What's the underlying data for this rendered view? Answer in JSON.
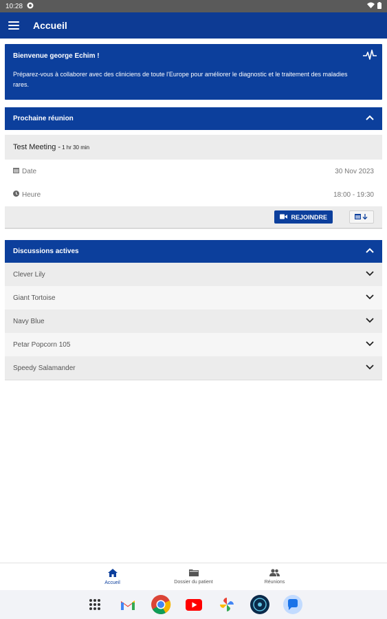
{
  "status_bar": {
    "time": "10:28"
  },
  "app_bar": {
    "title": "Accueil"
  },
  "welcome": {
    "title": "Bienvenue george Echim !",
    "text": "Préparez-vous à collaborer avec des cliniciens de toute l'Europe pour améliorer le diagnostic et le traitement des maladies rares."
  },
  "next_meeting": {
    "header": "Prochaine réunion",
    "name": "Test Meeting - ",
    "duration": "1 hr 30 min",
    "date_label": "Date",
    "date_value": "30 Nov 2023",
    "time_label": "Heure",
    "time_value": "18:00 - 19:30",
    "join_label": "REJOINDRE"
  },
  "discussions": {
    "header": "Discussions actives",
    "items": [
      {
        "label": "Clever Lily"
      },
      {
        "label": "Giant Tortoise"
      },
      {
        "label": "Navy Blue"
      },
      {
        "label": "Petar Popcorn 105"
      },
      {
        "label": "Speedy Salamander"
      }
    ]
  },
  "bottom_nav": {
    "items": [
      {
        "label": "Accueil",
        "icon": "home-icon"
      },
      {
        "label": "Dossier du patient",
        "icon": "folder-icon"
      },
      {
        "label": "Réunions",
        "icon": "people-icon"
      }
    ]
  },
  "dock": {
    "icons": [
      "apps-icon",
      "gmail-icon",
      "chrome-icon",
      "youtube-icon",
      "photos-icon",
      "app-icon",
      "messages-icon"
    ]
  },
  "colors": {
    "primary": "#0c3f9c",
    "row_alt": "#ececec"
  }
}
